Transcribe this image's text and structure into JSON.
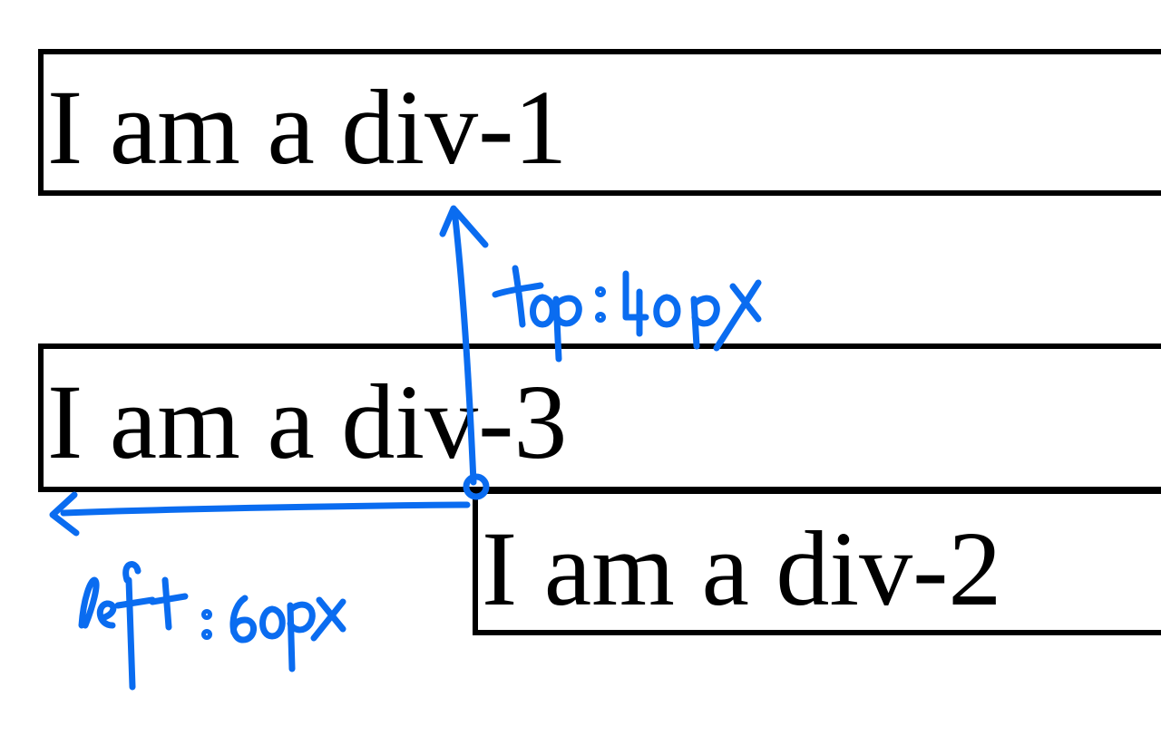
{
  "boxes": {
    "div1": "I am a div-1",
    "div3": "I am a div-3",
    "div2": "I am a div-2"
  },
  "annotations": {
    "top_note": "top: 40px",
    "left_note": "left: 60px"
  },
  "colors": {
    "border": "#000000",
    "annotation": "#0a6cf0"
  }
}
